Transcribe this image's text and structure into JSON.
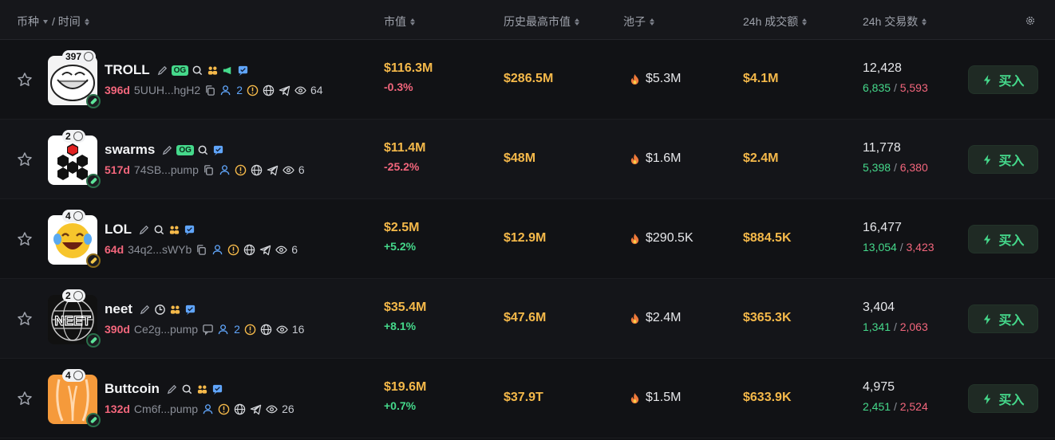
{
  "header": {
    "coin_label": "币种",
    "time_label": "/ 时间",
    "market_cap": "市值",
    "ath_market_cap": "历史最高市值",
    "pool": "池子",
    "volume_24h": "24h 成交额",
    "txns_24h": "24h 交易数"
  },
  "colors": {
    "accent_green": "#45d98b",
    "accent_red": "#f3667c",
    "accent_gold": "#f5b94a",
    "background": "#111215"
  },
  "rows": [
    {
      "holders": "397",
      "name": "TROLL",
      "age": "396d",
      "address": "5UUH...hgH2",
      "followers": "2",
      "views": "64",
      "market_cap": "$116.3M",
      "change": "-0.3%",
      "ath": "$286.5M",
      "pool": "$5.3M",
      "volume": "$4.1M",
      "txns": "12,428",
      "buys": "6,835",
      "sells": "5,593",
      "buy_label": "买入"
    },
    {
      "holders": "2",
      "name": "swarms",
      "age": "517d",
      "address": "74SB...pump",
      "followers": "",
      "views": "6",
      "market_cap": "$11.4M",
      "change": "-25.2%",
      "ath": "$48M",
      "pool": "$1.6M",
      "volume": "$2.4M",
      "txns": "11,778",
      "buys": "5,398",
      "sells": "6,380",
      "buy_label": "买入"
    },
    {
      "holders": "4",
      "name": "LOL",
      "age": "64d",
      "address": "34q2...sWYb",
      "followers": "",
      "views": "6",
      "market_cap": "$2.5M",
      "change": "+5.2%",
      "ath": "$12.9M",
      "pool": "$290.5K",
      "volume": "$884.5K",
      "txns": "16,477",
      "buys": "13,054",
      "sells": "3,423",
      "buy_label": "买入"
    },
    {
      "holders": "2",
      "name": "neet",
      "age": "390d",
      "address": "Ce2g...pump",
      "followers": "2",
      "views": "16",
      "market_cap": "$35.4M",
      "change": "+8.1%",
      "ath": "$47.6M",
      "pool": "$2.4M",
      "volume": "$365.3K",
      "txns": "3,404",
      "buys": "1,341",
      "sells": "2,063",
      "buy_label": "买入"
    },
    {
      "holders": "4",
      "name": "Buttcoin",
      "age": "132d",
      "address": "Cm6f...pump",
      "followers": "",
      "views": "26",
      "market_cap": "$19.6M",
      "change": "+0.7%",
      "ath": "$37.9T",
      "pool": "$1.5M",
      "volume": "$633.9K",
      "txns": "4,975",
      "buys": "2,451",
      "sells": "2,524",
      "buy_label": "买入"
    }
  ]
}
